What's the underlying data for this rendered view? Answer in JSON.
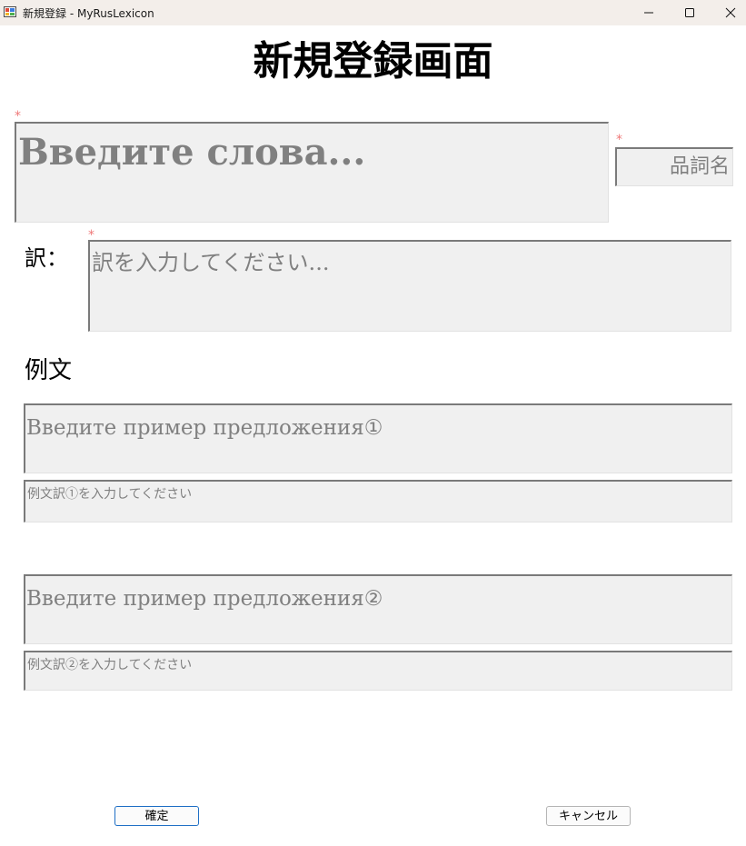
{
  "window": {
    "title": "新規登録 - MyRusLexicon",
    "minimize_icon": "minimize-icon",
    "maximize_icon": "maximize-icon",
    "close_icon": "close-icon"
  },
  "page": {
    "title": "新規登録画面",
    "required_mark": "*"
  },
  "word_input": {
    "placeholder": "Введите слова..."
  },
  "part_of_speech": {
    "placeholder": "品詞名"
  },
  "translation": {
    "label": "訳：",
    "placeholder": "訳を入力してください..."
  },
  "examples": {
    "heading": "例文",
    "items": [
      {
        "sentence_placeholder": "Введите пример предложения①",
        "translation_placeholder": "例文訳①を入力してください"
      },
      {
        "sentence_placeholder": "Введите пример предложения②",
        "translation_placeholder": "例文訳②を入力してください"
      }
    ]
  },
  "buttons": {
    "confirm": "確定",
    "cancel": "キャンセル"
  },
  "colors": {
    "required_mark": "#ef7878",
    "field_background": "#f0f0f0",
    "placeholder_text": "#808080",
    "confirm_border": "#1f6fc5",
    "titlebar": "#f3eeea"
  }
}
